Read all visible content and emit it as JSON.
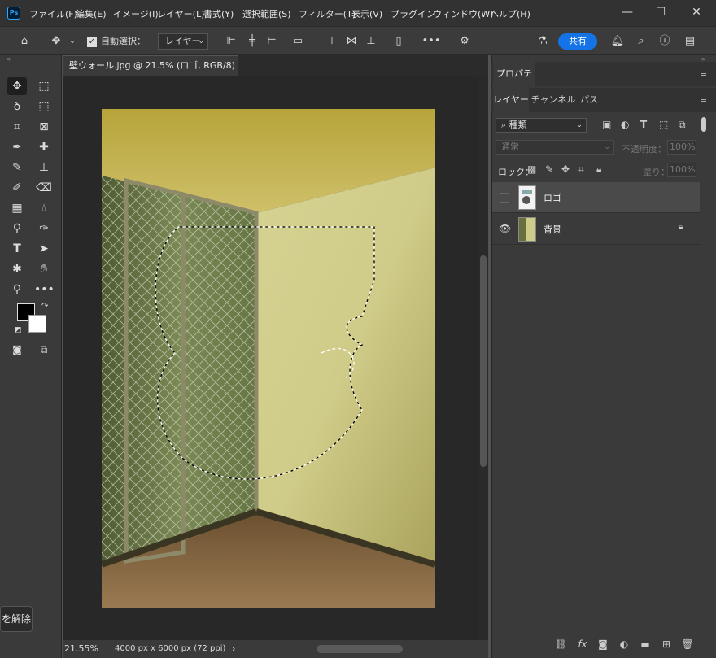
{
  "app": {
    "icon_text": "Ps"
  },
  "menu": [
    "ファイル(F)",
    "編集(E)",
    "イメージ(I)",
    "レイヤー(L)",
    "書式(Y)",
    "選択範囲(S)",
    "フィルター(T)",
    "表示(V)",
    "プラグイン",
    "ウィンドウ(W)",
    "ヘルプ(H)"
  ],
  "options": {
    "auto_select_label": "自動選択：",
    "auto_select_target": "レイヤー",
    "share_label": "共有"
  },
  "document": {
    "tab_title": "壁ウォール.jpg @ 21.5% (ロゴ, RGB/8) *"
  },
  "status": {
    "zoom": "21.55%",
    "doc_size": "4000 px x 6000 px (72 ppi)"
  },
  "tooltip": {
    "text": "を解除"
  },
  "properties_panel": {
    "tab": "プロパティ"
  },
  "layers_panel": {
    "tabs": [
      "レイヤー",
      "チャンネル",
      "パス"
    ],
    "filter_kind": "種類",
    "blend_mode": "通常",
    "opacity_label": "不透明度：",
    "opacity_value": "100%",
    "lock_label": "ロック：",
    "fill_label": "塗り：",
    "fill_value": "100%",
    "layers": [
      {
        "name": "ロゴ",
        "visible": false,
        "selected": true,
        "locked": false
      },
      {
        "name": "背景",
        "visible": true,
        "selected": false,
        "locked": true
      }
    ]
  }
}
